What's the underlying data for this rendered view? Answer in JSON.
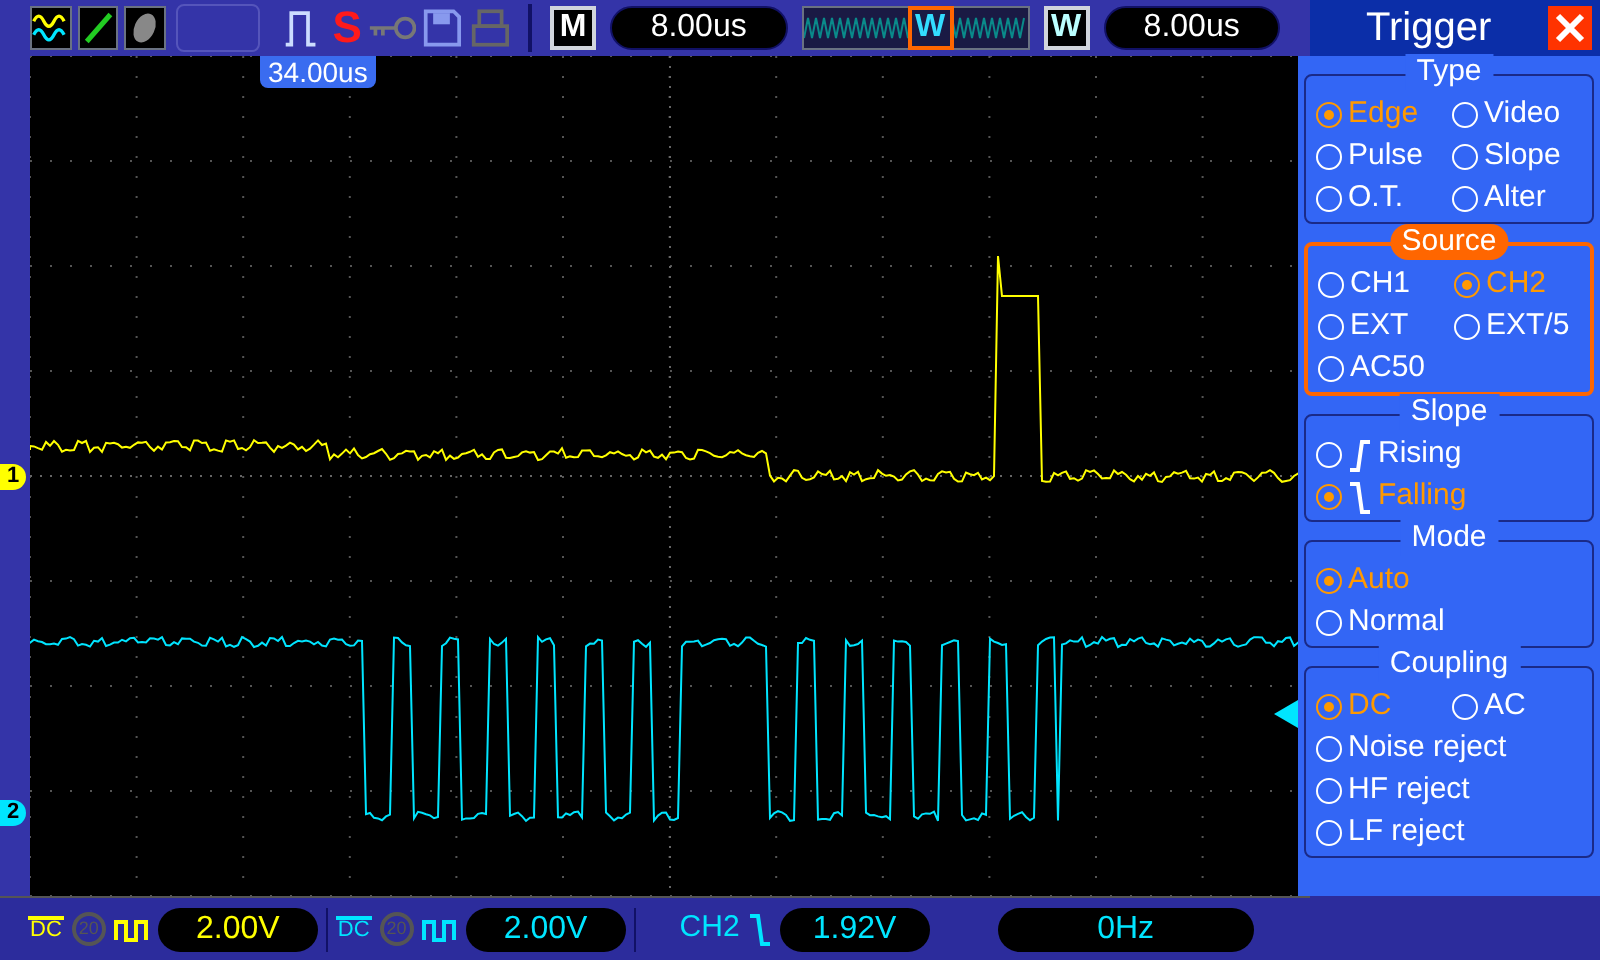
{
  "toolbar": {
    "run_label": "S",
    "menu_label": "M",
    "timebase": "8.00us",
    "zoom_marker": "W",
    "window_label": "W",
    "window_timebase": "8.00us"
  },
  "trigger_position": "34.00us",
  "channel_markers": [
    {
      "label": "1",
      "color": "#ffff00"
    },
    {
      "label": "2",
      "color": "#00e5ff"
    }
  ],
  "trigger_panel": {
    "title": "Trigger",
    "sections": [
      {
        "title": "Type",
        "active": false,
        "rows": [
          [
            {
              "label": "Edge",
              "selected": true
            },
            {
              "label": "Video",
              "selected": false
            }
          ],
          [
            {
              "label": "Pulse",
              "selected": false
            },
            {
              "label": "Slope",
              "selected": false
            }
          ],
          [
            {
              "label": "O.T.",
              "selected": false
            },
            {
              "label": "Alter",
              "selected": false
            }
          ]
        ]
      },
      {
        "title": "Source",
        "active": true,
        "rows": [
          [
            {
              "label": "CH1",
              "selected": false
            },
            {
              "label": "CH2",
              "selected": true
            }
          ],
          [
            {
              "label": "EXT",
              "selected": false
            },
            {
              "label": "EXT/5",
              "selected": false
            }
          ],
          [
            {
              "label": "AC50",
              "selected": false
            }
          ]
        ]
      },
      {
        "title": "Slope",
        "active": false,
        "rows": [
          [
            {
              "label": "Rising",
              "selected": false,
              "kind": "rising"
            }
          ],
          [
            {
              "label": "Falling",
              "selected": true,
              "kind": "falling"
            }
          ]
        ]
      },
      {
        "title": "Mode",
        "active": false,
        "rows": [
          [
            {
              "label": "Auto",
              "selected": true
            }
          ],
          [
            {
              "label": "Normal",
              "selected": false
            }
          ]
        ]
      },
      {
        "title": "Coupling",
        "active": false,
        "rows": [
          [
            {
              "label": "DC",
              "selected": true
            },
            {
              "label": "AC",
              "selected": false
            }
          ],
          [
            {
              "label": "Noise reject",
              "selected": false
            }
          ],
          [
            {
              "label": "HF reject",
              "selected": false
            }
          ],
          [
            {
              "label": "LF reject",
              "selected": false
            }
          ]
        ]
      }
    ]
  },
  "status_bar": {
    "channels": [
      {
        "coupling": "DC",
        "bandwidth": "20",
        "volts": "2.00V",
        "color": "#ffff00"
      },
      {
        "coupling": "DC",
        "bandwidth": "20",
        "volts": "2.00V",
        "color": "#00e5ff"
      }
    ],
    "trigger": {
      "source": "CH2",
      "level": "1.92V"
    },
    "frequency": "0Hz"
  }
}
